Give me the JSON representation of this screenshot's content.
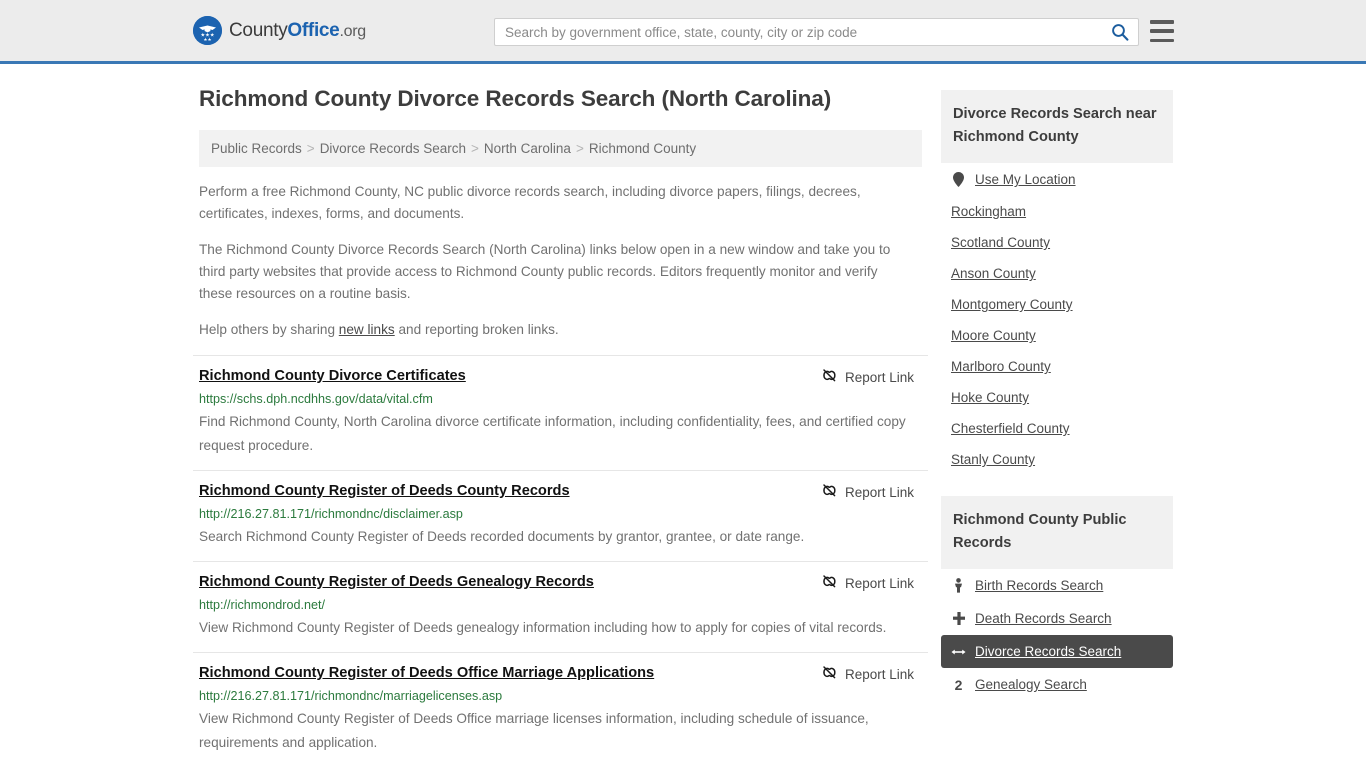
{
  "header": {
    "logo": {
      "text_1": "County",
      "text_2": "Office",
      "text_3": ".org",
      "icon": "eagle-seal-icon"
    },
    "search": {
      "placeholder": "Search by government office, state, county, city or zip code",
      "value": "",
      "search_icon": "search-icon"
    },
    "menu_icon": "hamburger-menu-icon",
    "accent_color": "#3a78b5",
    "background_color": "#ececec"
  },
  "page_title": "Richmond County Divorce Records Search (North Carolina)",
  "breadcrumb": {
    "items": [
      {
        "label": "Public Records"
      },
      {
        "label": "Divorce Records Search"
      },
      {
        "label": "North Carolina"
      },
      {
        "label": "Richmond County"
      }
    ],
    "separator": ">"
  },
  "intro": {
    "p1": "Perform a free Richmond County, NC public divorce records search, including divorce papers, filings, decrees, certificates, indexes, forms, and documents.",
    "p2": "The Richmond County Divorce Records Search (North Carolina) links below open in a new window and take you to third party websites that provide access to Richmond County public records. Editors frequently monitor and verify these resources on a routine basis.",
    "p3_before": "Help others by sharing ",
    "p3_link": "new links",
    "p3_after": " and reporting broken links."
  },
  "report_link_label": "Report Link",
  "report_link_icon": "broken-link-icon",
  "results": [
    {
      "title": "Richmond County Divorce Certificates",
      "url": "https://schs.dph.ncdhhs.gov/data/vital.cfm",
      "description": "Find Richmond County, North Carolina divorce certificate information, including confidentiality, fees, and certified copy request procedure."
    },
    {
      "title": "Richmond County Register of Deeds County Records",
      "url": "http://216.27.81.171/richmondnc/disclaimer.asp",
      "description": "Search Richmond County Register of Deeds recorded documents by grantor, grantee, or date range."
    },
    {
      "title": "Richmond County Register of Deeds Genealogy Records",
      "url": "http://richmondrod.net/",
      "description": "View Richmond County Register of Deeds genealogy information including how to apply for copies of vital records."
    },
    {
      "title": "Richmond County Register of Deeds Office Marriage Applications",
      "url": "http://216.27.81.171/richmondnc/marriagelicenses.asp",
      "description": "View Richmond County Register of Deeds Office marriage licenses information, including schedule of issuance, requirements and application."
    }
  ],
  "sidebar": {
    "nearby": {
      "heading": "Divorce Records Search near Richmond County",
      "use_my_location": {
        "label": "Use My Location",
        "icon": "map-pin-icon"
      },
      "counties": [
        {
          "label": "Rockingham"
        },
        {
          "label": "Scotland County"
        },
        {
          "label": "Anson County"
        },
        {
          "label": "Montgomery County"
        },
        {
          "label": "Moore County"
        },
        {
          "label": "Marlboro County"
        },
        {
          "label": "Hoke County"
        },
        {
          "label": "Chesterfield County"
        },
        {
          "label": "Stanly County"
        }
      ]
    },
    "public_records": {
      "heading": "Richmond County Public Records",
      "items": [
        {
          "label": "Birth Records Search",
          "icon": "baby-icon",
          "active": false
        },
        {
          "label": "Death Records Search",
          "icon": "cross-icon",
          "active": false
        },
        {
          "label": "Divorce Records Search",
          "icon": "split-arrows-icon",
          "active": true
        },
        {
          "label": "Genealogy Search",
          "icon": "family-tree-icon",
          "active": false
        }
      ],
      "active_background": "#4a4a4a"
    }
  }
}
